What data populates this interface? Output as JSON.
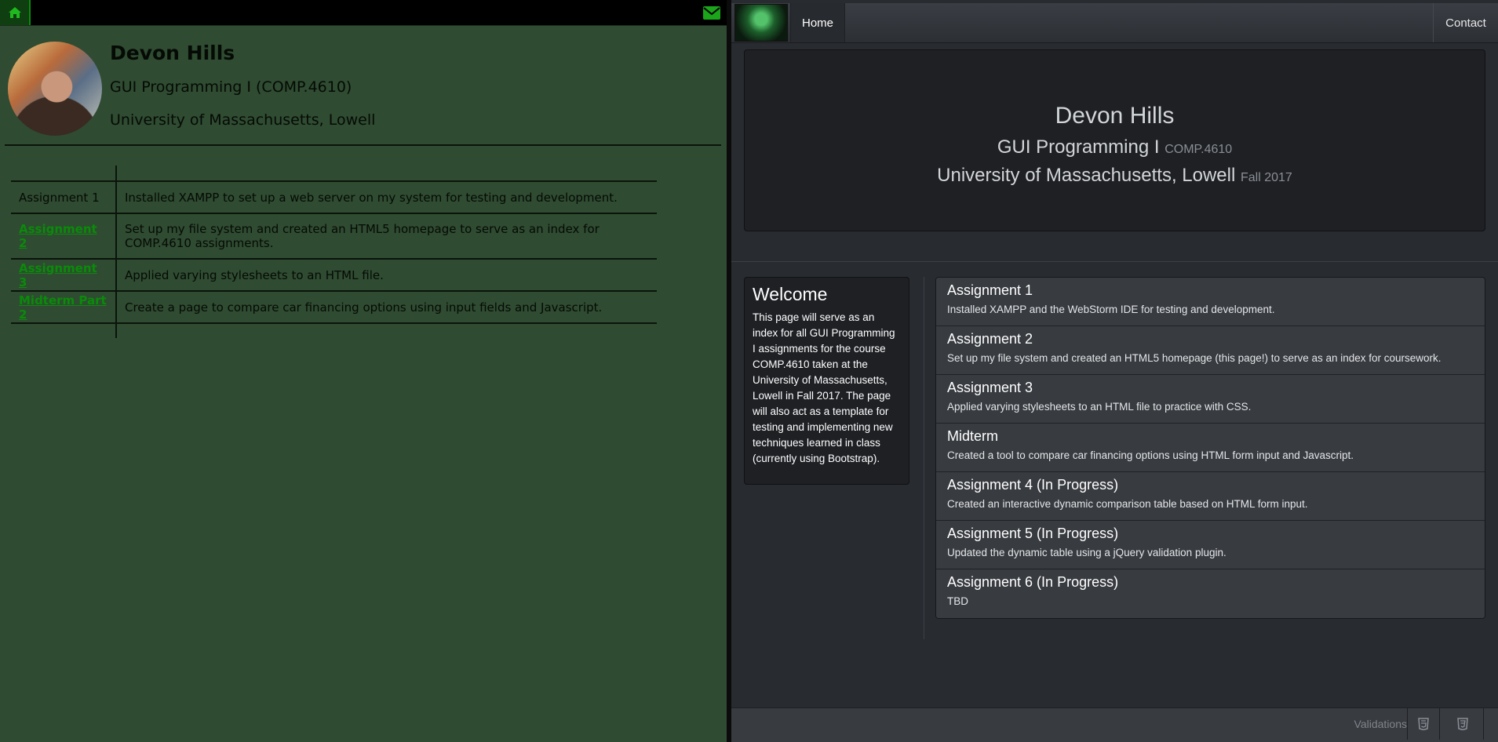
{
  "left": {
    "name": "Devon Hills",
    "course": "GUI Programming I (COMP.4610)",
    "university": "University of Massachusetts, Lowell",
    "rows": [
      {
        "label": "Assignment 1",
        "link": false,
        "desc": "Installed XAMPP to set up a web server on my system for testing and development."
      },
      {
        "label": "Assignment 2",
        "link": true,
        "desc": "Set up my file system and created an HTML5 homepage to serve as an index for COMP.4610 assignments."
      },
      {
        "label": "Assignment 3",
        "link": true,
        "desc": "Applied varying stylesheets to an HTML file."
      },
      {
        "label": "Midterm Part 2",
        "link": true,
        "desc": "Create a page to compare car financing options using input fields and Javascript."
      }
    ]
  },
  "right": {
    "nav": {
      "home": "Home",
      "contact": "Contact"
    },
    "jumbotron": {
      "name": "Devon Hills",
      "course": "GUI Programming I",
      "course_code": "COMP.4610",
      "university": "University of Massachusetts, Lowell",
      "term": "Fall 2017"
    },
    "welcome": {
      "title": "Welcome",
      "body": "This page will serve as an index for all GUI Programming I assignments for the course COMP.4610 taken at the University of Massachusetts, Lowell in Fall 2017. The page will also act as a template for testing and implementing new techniques learned in class (currently using Bootstrap)."
    },
    "assignments": [
      {
        "title": "Assignment 1",
        "desc": "Installed XAMPP and the WebStorm IDE for testing and development."
      },
      {
        "title": "Assignment 2",
        "desc": "Set up my file system and created an HTML5 homepage (this page!) to serve as an index for coursework."
      },
      {
        "title": "Assignment 3",
        "desc": "Applied varying stylesheets to an HTML file to practice with CSS."
      },
      {
        "title": "Midterm",
        "desc": "Created a tool to compare car financing options using HTML form input and Javascript."
      },
      {
        "title": "Assignment 4 (In Progress)",
        "desc": "Created an interactive dynamic comparison table based on HTML form input."
      },
      {
        "title": "Assignment 5 (In Progress)",
        "desc": "Updated the dynamic table using a jQuery validation plugin."
      },
      {
        "title": "Assignment 6 (In Progress)",
        "desc": "TBD"
      }
    ],
    "footer": {
      "validations": "Validations"
    }
  },
  "icons": {
    "home": "home-icon",
    "mail": "envelope-icon",
    "html5": "html5-icon",
    "css3": "css3-icon"
  }
}
